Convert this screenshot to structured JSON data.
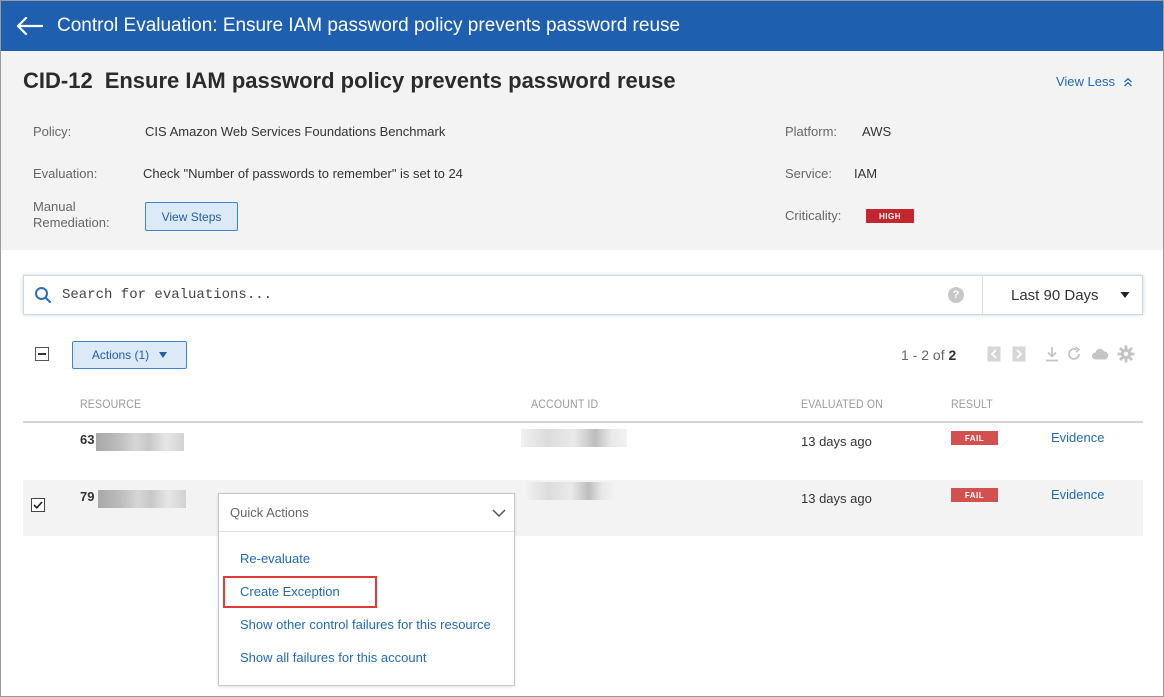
{
  "header": {
    "title": "Control Evaluation: Ensure IAM password policy prevents password reuse"
  },
  "control": {
    "cid": "CID-12",
    "name": "Ensure IAM password policy prevents password reuse",
    "view_less": "View Less",
    "policy_label": "Policy:",
    "policy_value": "CIS Amazon Web Services Foundations Benchmark",
    "evaluation_label": "Evaluation:",
    "evaluation_value": "Check \"Number of passwords to remember\" is set to 24",
    "manual_remediation_label_1": "Manual",
    "manual_remediation_label_2": "Remediation:",
    "view_steps": "View Steps",
    "platform_label": "Platform:",
    "platform_value": "AWS",
    "service_label": "Service:",
    "service_value": "IAM",
    "criticality_label": "Criticality:",
    "criticality_value": "HIGH",
    "criticality_color": "#c4262e"
  },
  "search": {
    "placeholder": "Search for evaluations...",
    "range": "Last 90 Days"
  },
  "toolbar": {
    "actions_label": "Actions (1)",
    "pager_prefix": "1 - 2 of",
    "pager_total": "2"
  },
  "table": {
    "columns": [
      "RESOURCE",
      "ACCOUNT ID",
      "EVALUATED ON",
      "RESULT"
    ],
    "rows": [
      {
        "resource_prefix": "63",
        "evaluated_on": "13 days ago",
        "result": "FAIL",
        "evidence": "Evidence",
        "selected": false
      },
      {
        "resource_prefix": "79",
        "evaluated_on": "13 days ago",
        "result": "FAIL",
        "evidence": "Evidence",
        "selected": true
      }
    ],
    "fail_color": "#d2504d"
  },
  "quick_actions": {
    "title": "Quick Actions",
    "items": [
      "Re-evaluate",
      "Create Exception",
      "Show other control failures for this resource",
      "Show all failures for this account"
    ]
  },
  "colors": {
    "brand": "#1e5fb0",
    "link": "#1f6ab5",
    "highlight": "#e53935"
  }
}
